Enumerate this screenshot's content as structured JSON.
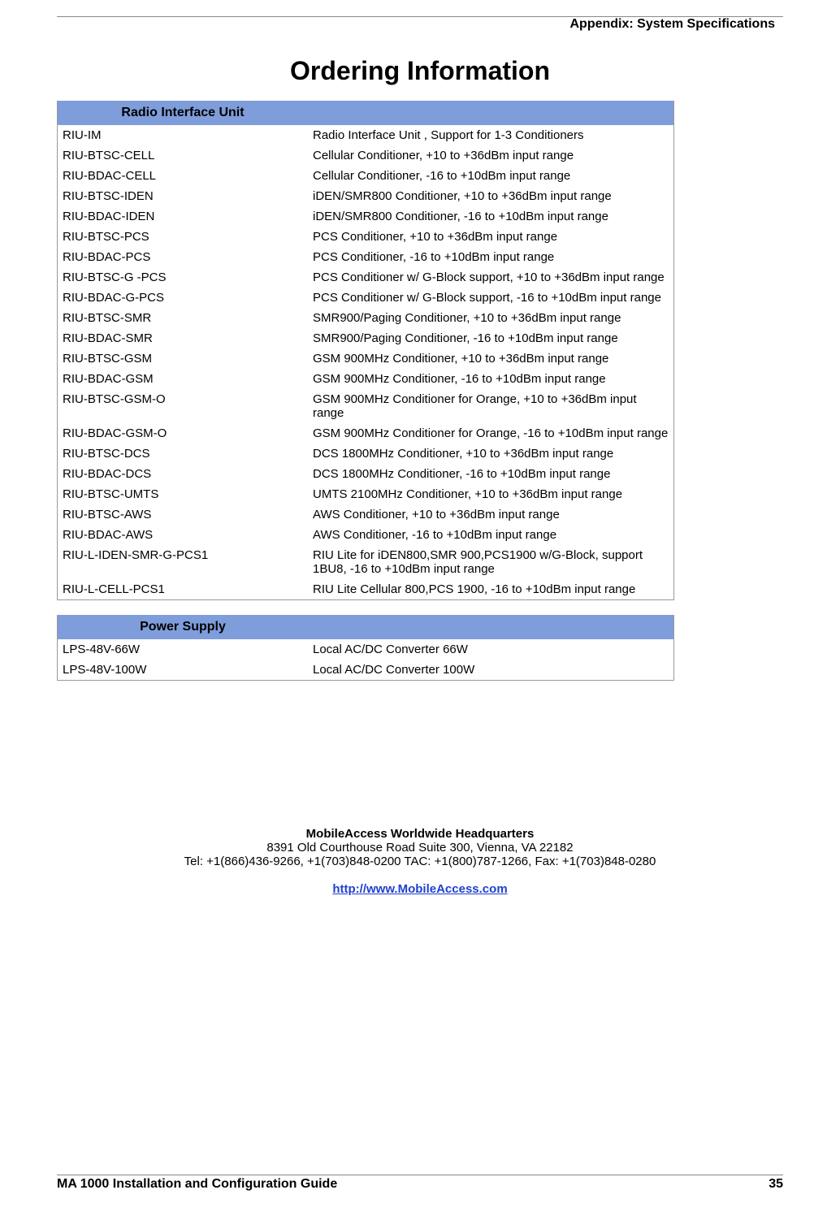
{
  "header_right": "Appendix: System Specifications",
  "title": "Ordering Information",
  "tables": [
    {
      "header": "Radio Interface Unit",
      "rows": [
        {
          "code": "RIU-IM",
          "desc": "Radio Interface Unit , Support for 1-3 Conditioners"
        },
        {
          "code": "RIU-BTSC-CELL",
          "desc": "Cellular Conditioner, +10 to +36dBm input range"
        },
        {
          "code": "RIU-BDAC-CELL",
          "desc": "Cellular Conditioner, -16 to +10dBm input range"
        },
        {
          "code": "RIU-BTSC-IDEN",
          "desc": "iDEN/SMR800 Conditioner, +10 to +36dBm input range"
        },
        {
          "code": "RIU-BDAC-IDEN",
          "desc": "iDEN/SMR800 Conditioner, -16 to +10dBm input range"
        },
        {
          "code": "RIU-BTSC-PCS",
          "desc": "PCS Conditioner, +10 to +36dBm input range"
        },
        {
          "code": "RIU-BDAC-PCS",
          "desc": "PCS Conditioner, -16 to +10dBm input range"
        },
        {
          "code": "RIU-BTSC-G -PCS",
          "desc": "PCS Conditioner w/ G-Block support, +10 to +36dBm input range"
        },
        {
          "code": "RIU-BDAC-G-PCS",
          "desc": "PCS Conditioner w/ G-Block support, -16 to +10dBm input range"
        },
        {
          "code": "RIU-BTSC-SMR",
          "desc": "SMR900/Paging Conditioner, +10 to +36dBm input range"
        },
        {
          "code": "RIU-BDAC-SMR",
          "desc": "SMR900/Paging Conditioner, -16 to +10dBm input range"
        },
        {
          "code": "RIU-BTSC-GSM",
          "desc": "GSM 900MHz Conditioner, +10 to +36dBm input range"
        },
        {
          "code": "RIU-BDAC-GSM",
          "desc": "GSM 900MHz Conditioner, -16 to +10dBm input range"
        },
        {
          "code": "RIU-BTSC-GSM-O",
          "desc": "GSM 900MHz Conditioner for Orange, +10 to +36dBm input range"
        },
        {
          "code": "RIU-BDAC-GSM-O",
          "desc": "GSM 900MHz Conditioner for Orange, -16 to +10dBm input range"
        },
        {
          "code": "RIU-BTSC-DCS",
          "desc": "DCS 1800MHz Conditioner, +10 to +36dBm input range"
        },
        {
          "code": "RIU-BDAC-DCS",
          "desc": "DCS 1800MHz Conditioner, -16 to +10dBm input range"
        },
        {
          "code": "RIU-BTSC-UMTS",
          "desc": "UMTS 2100MHz Conditioner, +10 to +36dBm input range"
        },
        {
          "code": "RIU-BTSC-AWS",
          "desc": "AWS Conditioner, +10 to +36dBm input range",
          "small": true
        },
        {
          "code": "RIU-BDAC-AWS",
          "desc": "AWS Conditioner, -16 to +10dBm input range",
          "small_code": true
        },
        {
          "code": "RIU-L-IDEN-SMR-G-PCS1",
          "desc": "RIU Lite for iDEN800,SMR 900,PCS1900 w/G-Block, support 1BU8, -16 to +10dBm input range"
        },
        {
          "code": "RIU-L-CELL-PCS1",
          "desc": "RIU Lite Cellular 800,PCS 1900, -16 to +10dBm input range"
        }
      ]
    },
    {
      "header": "Power Supply",
      "rows": [
        {
          "code": "LPS-48V-66W",
          "desc": "Local AC/DC Converter 66W"
        },
        {
          "code": "LPS-48V-100W",
          "desc": "Local AC/DC Converter 100W"
        }
      ]
    }
  ],
  "footer": {
    "title": "MobileAccess Worldwide Headquarters",
    "address": "8391 Old Courthouse Road Suite 300, Vienna, VA 22182",
    "phones": "Tel: +1(866)436-9266, +1(703)848-0200 TAC: +1(800)787-1266, Fax: +1(703)848-0280",
    "link_text": "http://www.MobileAccess.com",
    "link_href": "http://www.MobileAccess.com"
  },
  "bottom": {
    "left": "MA 1000 Installation and Configuration Guide",
    "right": "35"
  }
}
